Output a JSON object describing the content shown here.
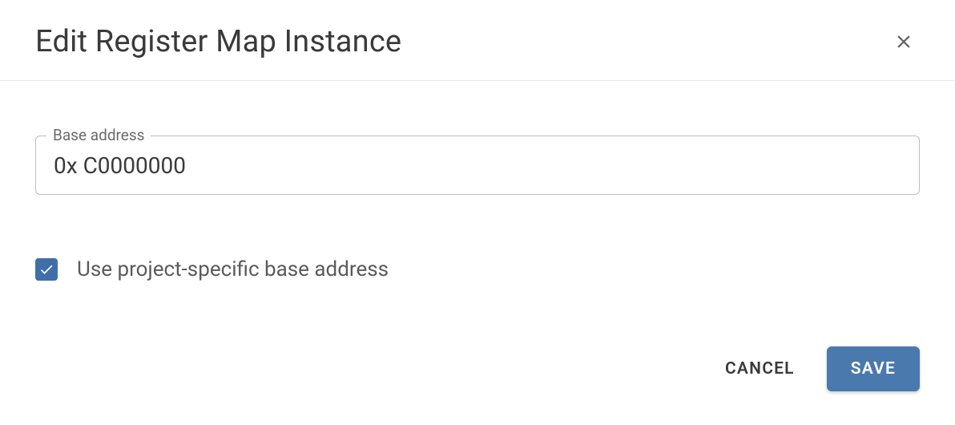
{
  "dialog": {
    "title": "Edit Register Map Instance"
  },
  "form": {
    "base_address": {
      "label": "Base address",
      "value": "0x C0000000"
    },
    "use_project_specific": {
      "label": "Use project-specific base address",
      "checked": true
    }
  },
  "actions": {
    "cancel": "Cancel",
    "save": "Save"
  }
}
